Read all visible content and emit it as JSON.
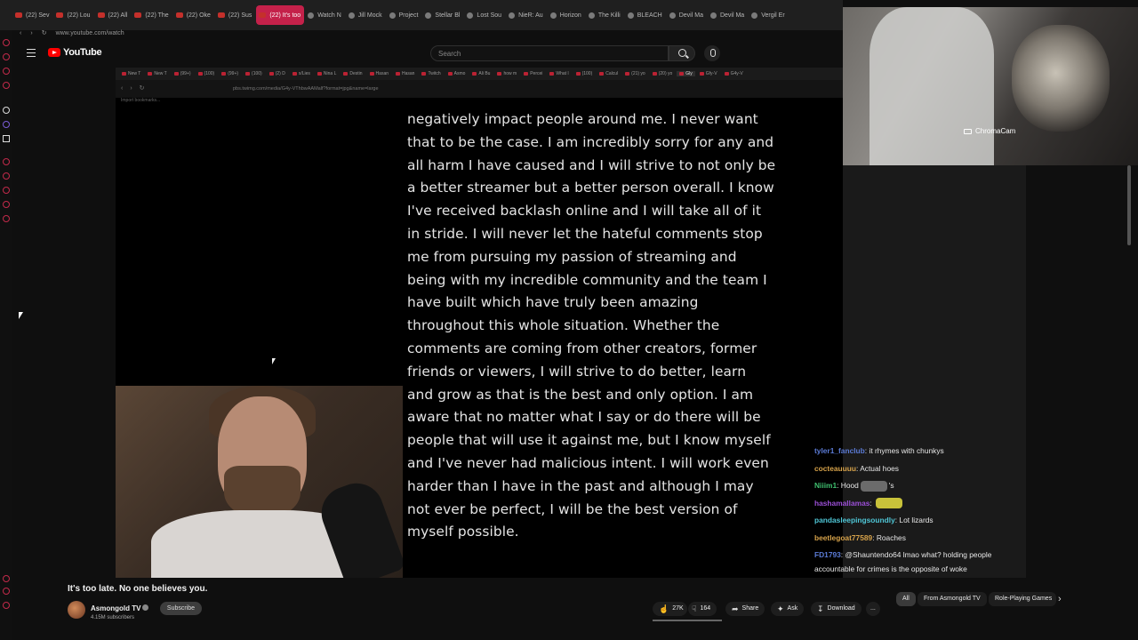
{
  "browser": {
    "tabs": [
      {
        "label": "(22) Sev"
      },
      {
        "label": "(22) Lou"
      },
      {
        "label": "(22) All"
      },
      {
        "label": "(22) The"
      },
      {
        "label": "(22) Oke"
      },
      {
        "label": "(22) Sus"
      },
      {
        "label": "(22) It's too"
      },
      {
        "label": "Watch N"
      },
      {
        "label": "Jill Mock"
      },
      {
        "label": "Project"
      },
      {
        "label": "Stellar Bl"
      },
      {
        "label": "Lost Sou"
      },
      {
        "label": "NieR: Au"
      },
      {
        "label": "Horizon"
      },
      {
        "label": "The Killi"
      },
      {
        "label": "BLEACH"
      },
      {
        "label": "Devil Ma"
      },
      {
        "label": "Devil Ma"
      },
      {
        "label": "Vergil Er"
      }
    ],
    "active_tab_index": 6,
    "url": "www.youtube.com/watch"
  },
  "youtube": {
    "logo_text": "YouTube",
    "search_placeholder": "Search"
  },
  "video": {
    "inner_tabs": [
      {
        "label": "New T"
      },
      {
        "label": "New T"
      },
      {
        "label": "(99+)"
      },
      {
        "label": "(100)"
      },
      {
        "label": "(99+)"
      },
      {
        "label": "(100)"
      },
      {
        "label": "(2) D"
      },
      {
        "label": "x/Lies"
      },
      {
        "label": "Nina L"
      },
      {
        "label": "Destin"
      },
      {
        "label": "Hasan"
      },
      {
        "label": "Hasan"
      },
      {
        "label": "Twitch"
      },
      {
        "label": "Asmo"
      },
      {
        "label": "Ali Bu"
      },
      {
        "label": "how m"
      },
      {
        "label": "Percei"
      },
      {
        "label": "What l"
      },
      {
        "label": "(100)"
      },
      {
        "label": "Calcul"
      },
      {
        "label": "(21) yo"
      },
      {
        "label": "(20) yo"
      },
      {
        "label": "Gly"
      },
      {
        "label": "Gfy-V"
      },
      {
        "label": "G4y-V"
      }
    ],
    "inner_url": "pbs.twimg.com/media/G4y-VThbwAAMalf?format=jpg&name=large",
    "bookmarks_label": "Import bookmarks...",
    "statement_text": "negatively impact people around me. I never want that to be the case. I am incredibly sorry for any and all harm I have caused and I will strive to not only be a better streamer but a better person overall. I know I've received backlash online and I will take all of it in stride. I will never let the hateful comments stop me from pursuing my passion of streaming and being with my incredible community and the team I have built which have truly been amazing throughout this whole situation. Whether the comments are coming from other creators, former friends or viewers, I will strive to do better, learn and grow as that is the best and only option. I am aware that no matter what I say or do there will be people that will use it against me, but I know myself and I've never had malicious intent. I will work even harder than I have in the past and although I may not ever be perfect, I will be the best version of myself possible."
  },
  "chromacam": {
    "label": "ChromaCam"
  },
  "chat": {
    "messages": [
      {
        "user": "tyler1_fanclub",
        "text": "it rhymes with chunkys",
        "color": "#5b7bd6"
      },
      {
        "user": "cocteauuuu",
        "text": "Actual hoes",
        "color": "#d6a24a"
      },
      {
        "user": "Niiim1",
        "text": "Hood",
        "suffix": "'s",
        "color": "#3fbf6f"
      },
      {
        "user": "hashamallamas",
        "text": "",
        "color": "#9b4fd6"
      },
      {
        "user": "pandasleepingsoundly",
        "text": "Lot lizards",
        "color": "#4fc6d6"
      },
      {
        "user": "beetlegoat77589",
        "text": "Roaches",
        "color": "#d6a24a"
      },
      {
        "user": "FD1793",
        "text": "@Shauntendo64 lmao what? holding people accountable for crimes is the opposite of woke",
        "color": "#5b7bd6"
      }
    ]
  },
  "below": {
    "title": "It's too late. No one believes you.",
    "channel_name": "Asmongold TV",
    "subscribers": "4.15M subscribers",
    "subscribe_label": "Subscribe",
    "likes": "27K",
    "dislikes": "164",
    "share_label": "Share",
    "ask_label": "Ask",
    "download_label": "Download",
    "more_label": "...",
    "chips": [
      {
        "label": "All",
        "selected": true
      },
      {
        "label": "From Asmongold TV",
        "selected": false
      },
      {
        "label": "Role-Playing Games",
        "selected": false
      }
    ]
  }
}
